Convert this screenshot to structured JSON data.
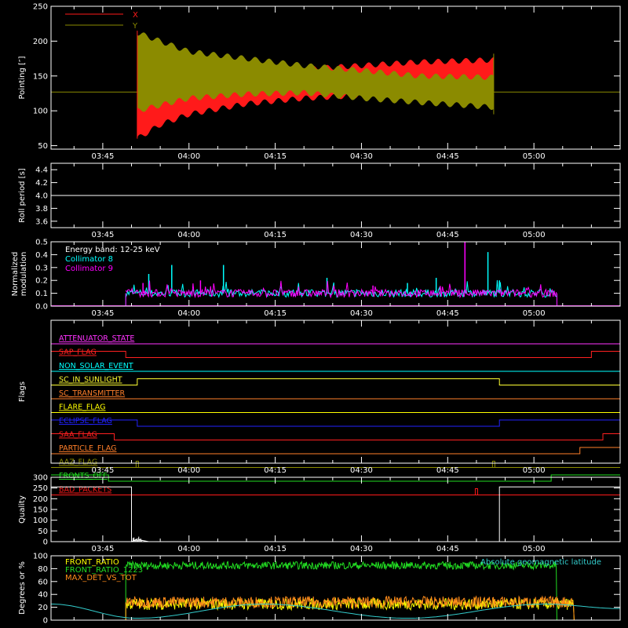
{
  "chart_data": [
    {
      "id": "pointing",
      "type": "line",
      "ylabel": "Pointing [″]",
      "yticks": [
        50,
        100,
        150,
        200,
        250
      ],
      "ylim": [
        45,
        250
      ],
      "xlim": [
        "03:36",
        "05:15"
      ],
      "xticks": [
        "03:45",
        "04:00",
        "04:15",
        "04:30",
        "04:45",
        "05:00"
      ],
      "data_interval": [
        "03:51",
        "04:53"
      ],
      "baseline_value": 127,
      "series": [
        {
          "name": "X",
          "color": "#ff1a1a",
          "envelope": [
            {
              "t": "03:51",
              "lo": 60,
              "hi": 130
            },
            {
              "t": "03:55",
              "lo": 80,
              "hi": 145
            },
            {
              "t": "04:00",
              "lo": 95,
              "hi": 148
            },
            {
              "t": "04:10",
              "lo": 110,
              "hi": 152
            },
            {
              "t": "04:20",
              "lo": 118,
              "hi": 160
            },
            {
              "t": "04:30",
              "lo": 122,
              "hi": 165
            },
            {
              "t": "04:40",
              "lo": 125,
              "hi": 170
            },
            {
              "t": "04:53",
              "lo": 127,
              "hi": 173
            }
          ]
        },
        {
          "name": "Y",
          "color": "#8b8b00",
          "envelope": [
            {
              "t": "03:51",
              "lo": 100,
              "hi": 212
            },
            {
              "t": "03:55",
              "lo": 108,
              "hi": 200
            },
            {
              "t": "04:00",
              "lo": 118,
              "hi": 185
            },
            {
              "t": "04:10",
              "lo": 124,
              "hi": 175
            },
            {
              "t": "04:20",
              "lo": 126,
              "hi": 165
            },
            {
              "t": "04:30",
              "lo": 118,
              "hi": 158
            },
            {
              "t": "04:40",
              "lo": 112,
              "hi": 150
            },
            {
              "t": "04:53",
              "lo": 105,
              "hi": 148
            }
          ]
        }
      ]
    },
    {
      "id": "roll",
      "type": "line",
      "ylabel": "Roll period [s]",
      "yticks": [
        "3.6",
        "3.8",
        "4.0",
        "4.2",
        "4.4"
      ],
      "ylim": [
        3.5,
        4.5
      ],
      "xticks": [
        "03:45",
        "04:00",
        "04:15",
        "04:30",
        "04:45",
        "05:00"
      ],
      "series": [
        {
          "name": "",
          "color": "#ffffff",
          "x": [
            "03:36",
            "05:15"
          ],
          "y": [
            4.0,
            4.0
          ]
        }
      ]
    },
    {
      "id": "modulation",
      "type": "line",
      "ylabel_lines": [
        "Normalized",
        "modulation"
      ],
      "yticks": [
        "0.0",
        "0.1",
        "0.2",
        "0.3",
        "0.4",
        "0.5"
      ],
      "ylim": [
        0,
        0.5
      ],
      "xticks": [
        "03:45",
        "04:00",
        "04:15",
        "04:30",
        "04:45",
        "05:00"
      ],
      "legend_title": "Energy band: 12-25 keV",
      "series": [
        {
          "name": "Collimator 8",
          "color": "#00ffff",
          "typical": 0.1,
          "spikes": [
            [
              "03:53",
              0.25
            ],
            [
              "03:57",
              0.32
            ],
            [
              "04:06",
              0.32
            ],
            [
              "04:24",
              0.22
            ],
            [
              "04:38",
              0.18
            ],
            [
              "04:43",
              0.22
            ],
            [
              "04:52",
              0.42
            ],
            [
              "04:54",
              0.2
            ]
          ]
        },
        {
          "name": "Collimator 9",
          "color": "#ff00ff",
          "typical": 0.1,
          "spikes": [
            [
              "03:52",
              0.18
            ],
            [
              "04:02",
              0.2
            ],
            [
              "04:32",
              0.16
            ],
            [
              "04:48",
              0.5
            ]
          ]
        }
      ],
      "data_interval": [
        "03:49",
        "05:04"
      ]
    },
    {
      "id": "flags",
      "type": "line",
      "ylabel": "Flags",
      "xticks": [
        "03:45",
        "04:00",
        "04:15",
        "04:30",
        "04:45",
        "05:00"
      ],
      "flags": [
        {
          "label": "ATTENUATOR_STATE",
          "color": "#ff33ff",
          "steps": []
        },
        {
          "label": "SAP_FLAG",
          "color": "#ff2020",
          "steps": [
            [
              "03:36",
              1
            ],
            [
              "03:49",
              0
            ],
            [
              "05:10",
              1
            ]
          ]
        },
        {
          "label": "NON_SOLAR_EVENT",
          "color": "#00ffff",
          "steps": []
        },
        {
          "label": "SC_IN_SUNLIGHT",
          "color": "#ffff33",
          "steps": [
            [
              "03:36",
              0
            ],
            [
              "03:51",
              1
            ],
            [
              "04:54",
              0
            ]
          ]
        },
        {
          "label": "SC_TRANSMITTER",
          "color": "#ff7f2a",
          "steps": []
        },
        {
          "label": "FLARE_FLAG",
          "color": "#ffff00",
          "steps": []
        },
        {
          "label": "ECLIPSE_FLAG",
          "color": "#2222ff",
          "steps": [
            [
              "03:36",
              1
            ],
            [
              "03:51",
              0
            ],
            [
              "04:54",
              1
            ]
          ]
        },
        {
          "label": "SAA_FLAG",
          "color": "#ff2020",
          "steps": [
            [
              "03:36",
              1
            ],
            [
              "03:47",
              0
            ],
            [
              "05:12",
              1
            ]
          ]
        },
        {
          "label": "PARTICLE_FLAG",
          "color": "#ff7f2a",
          "steps": [
            [
              "03:36",
              0
            ],
            [
              "05:08",
              1
            ]
          ]
        },
        {
          "label": "AAZ_FLAG",
          "color": "#8b8b00",
          "steps": [
            [
              "03:51",
              "pulse"
            ],
            [
              "04:53",
              "pulse"
            ]
          ]
        },
        {
          "label": "FRONTS_OFF",
          "color": "#22dd22",
          "steps": [
            [
              "03:36",
              1
            ],
            [
              "03:46",
              0
            ],
            [
              "05:03",
              1
            ]
          ]
        },
        {
          "label": "BAD_PACKETS",
          "color": "#ff1a1a",
          "steps": [
            [
              "04:50",
              "pulse"
            ]
          ]
        }
      ]
    },
    {
      "id": "quality",
      "type": "line",
      "ylabel": "Quality",
      "yticks": [
        0,
        50,
        100,
        150,
        200,
        250,
        300
      ],
      "ylim": [
        0,
        300
      ],
      "xticks": [
        "03:45",
        "04:00",
        "04:15",
        "04:30",
        "04:45",
        "05:00"
      ],
      "series": [
        {
          "name": "",
          "color": "#ffffff",
          "x": [
            "03:36",
            "03:50",
            "03:50",
            "03:51",
            "03:52",
            "03:53",
            "04:54",
            "04:54",
            "05:15"
          ],
          "y": [
            255,
            255,
            0,
            12,
            5,
            0,
            0,
            255,
            255
          ]
        }
      ]
    },
    {
      "id": "ratios",
      "type": "line",
      "ylabel": "Degrees or %",
      "yticks": [
        0,
        20,
        40,
        60,
        80,
        100
      ],
      "ylim": [
        0,
        100
      ],
      "xticks": [
        "03:45",
        "04:00",
        "04:15",
        "04:30",
        "04:45",
        "05:00"
      ],
      "series": [
        {
          "name": "FRONT_RATIO",
          "color": "#ffff00",
          "typical": 25,
          "interval": [
            "03:49",
            "05:07"
          ]
        },
        {
          "name": "FRONT_RATIO_1223",
          "color": "#22dd22",
          "typical": 85,
          "interval": [
            "03:49",
            "05:04"
          ]
        },
        {
          "name": "MAX_DET_VS_TOT",
          "color": "#ff8c1a",
          "typical": 28,
          "interval": [
            "03:49",
            "05:07"
          ]
        },
        {
          "name": "Absolute geomagnetic latitude",
          "color": "#33cccc",
          "x": [
            "03:36",
            "03:51",
            "04:13",
            "04:38",
            "05:02",
            "05:15"
          ],
          "y": [
            25,
            3,
            25,
            3,
            25,
            18
          ]
        }
      ]
    }
  ]
}
